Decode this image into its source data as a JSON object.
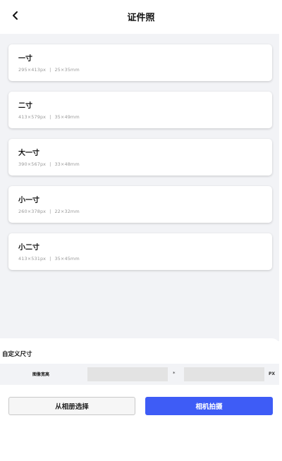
{
  "header": {
    "title": "证件照",
    "back_icon": "chevron-left-icon"
  },
  "sizes": [
    {
      "name": "一寸",
      "px": "295×413px",
      "sep": "|",
      "mm": "25×35mm"
    },
    {
      "name": "二寸",
      "px": "413×579px",
      "sep": "|",
      "mm": "35×49mm"
    },
    {
      "name": "大一寸",
      "px": "390×567px",
      "sep": "|",
      "mm": "33×48mm"
    },
    {
      "name": "小一寸",
      "px": "260×378px",
      "sep": "|",
      "mm": "22×32mm"
    },
    {
      "name": "小二寸",
      "px": "413×531px",
      "sep": "|",
      "mm": "35×45mm"
    }
  ],
  "custom": {
    "title": "自定义尺寸",
    "label": "图像宽高",
    "width_value": "",
    "height_value": "",
    "times": "*",
    "unit": "PX"
  },
  "actions": {
    "album_label": "从相册选择",
    "camera_label": "相机拍摄"
  },
  "colors": {
    "primary": "#3e5cf6",
    "list_background": "#f2f3f6"
  }
}
